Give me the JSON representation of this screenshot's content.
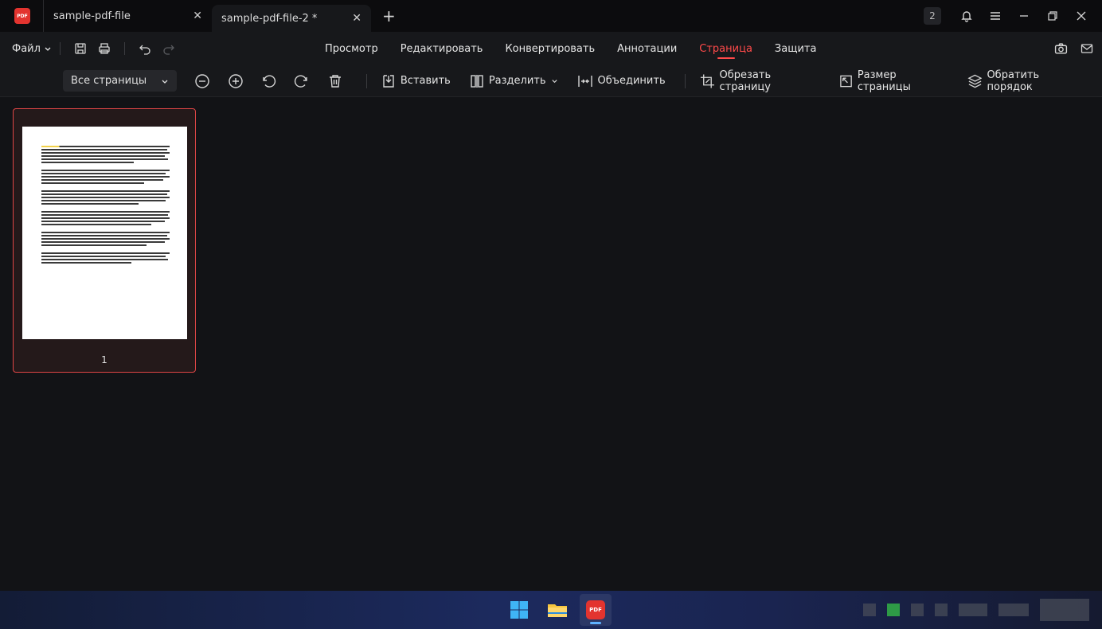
{
  "tabs": [
    {
      "label": "sample-pdf-file",
      "active": false
    },
    {
      "label": "sample-pdf-file-2 *",
      "active": true
    }
  ],
  "title_badge": "2",
  "app_logo_text": "PDF",
  "menu": {
    "file_label": "Файл",
    "nav": [
      {
        "label": "Просмотр",
        "active": false
      },
      {
        "label": "Редактировать",
        "active": false
      },
      {
        "label": "Конвертировать",
        "active": false
      },
      {
        "label": "Аннотации",
        "active": false
      },
      {
        "label": "Страница",
        "active": true
      },
      {
        "label": "Защита",
        "active": false
      }
    ]
  },
  "toolbar": {
    "page_select": "Все страницы",
    "insert_label": "Вставить",
    "split_label": "Разделить",
    "merge_label": "Объединить",
    "crop_label": "Обрезать страницу",
    "size_label": "Размер страницы",
    "reverse_label": "Обратить порядок"
  },
  "pages": [
    {
      "number": "1",
      "selected": true
    }
  ],
  "colors": {
    "accent": "#ff4a4a",
    "background": "#121316",
    "toolbar": "#17181b"
  },
  "icons": [
    "pdf-app-icon",
    "bell-icon",
    "hamburger-icon",
    "minimize-icon",
    "restore-icon",
    "close-icon",
    "save-icon",
    "print-icon",
    "undo-icon",
    "redo-icon",
    "camera-icon",
    "mail-icon",
    "zoom-out-icon",
    "zoom-in-icon",
    "rotate-left-icon",
    "rotate-right-icon",
    "trash-icon",
    "windows-start-icon",
    "file-explorer-icon"
  ]
}
